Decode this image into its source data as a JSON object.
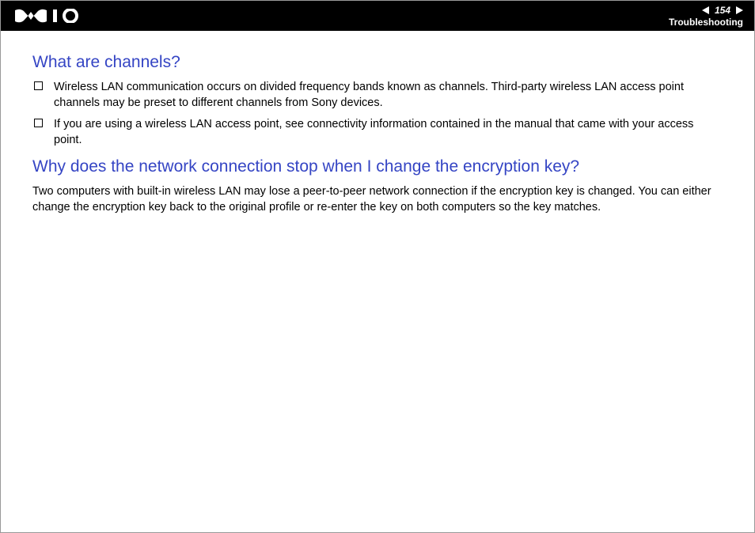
{
  "header": {
    "page_number": "154",
    "section": "Troubleshooting"
  },
  "content": {
    "heading1": "What are channels?",
    "list1": [
      "Wireless LAN communication occurs on divided frequency bands known as channels. Third-party wireless LAN access point channels may be preset to different channels from Sony devices.",
      "If you are using a wireless LAN access point, see connectivity information contained in the manual that came with your access point."
    ],
    "heading2": "Why does the network connection stop when I change the encryption key?",
    "paragraph1": "Two computers with built-in wireless LAN may lose a peer-to-peer network connection if the encryption key is changed. You can either change the encryption key back to the original profile or re-enter the key on both computers so the key matches."
  }
}
